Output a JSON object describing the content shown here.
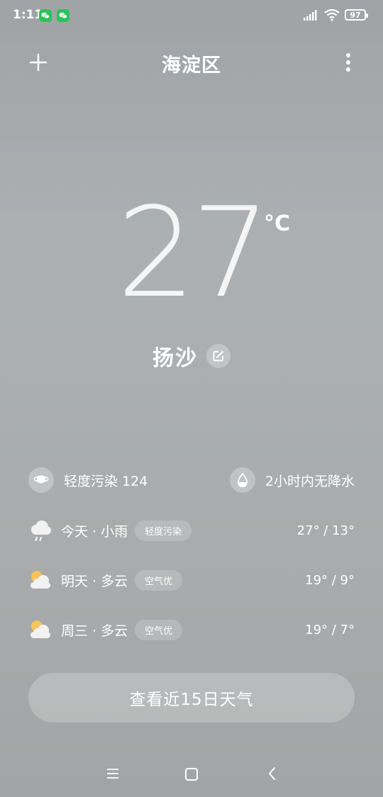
{
  "status_bar": {
    "time": "1:11",
    "battery": "97",
    "notification_icons": [
      "wechat-icon",
      "wechat-icon"
    ]
  },
  "header": {
    "title": "海淀区",
    "add_icon": "plus-icon",
    "more_icon": "more-vertical-icon"
  },
  "current": {
    "temperature": "27",
    "unit": "°C",
    "condition": "扬沙",
    "edit_icon": "edit-icon"
  },
  "info": {
    "air_quality": "轻度污染 124",
    "precipitation": "2小时内无降水"
  },
  "forecast": [
    {
      "day": "今天 · 小雨",
      "air": "轻度污染",
      "temps": "27° / 13°",
      "icon": "rain-cloud-icon"
    },
    {
      "day": "明天 · 多云",
      "air": "空气优",
      "temps": "19° / 9°",
      "icon": "partly-cloudy-icon"
    },
    {
      "day": "周三 · 多云",
      "air": "空气优",
      "temps": "19° / 7°",
      "icon": "partly-cloudy-icon"
    }
  ],
  "button_15day": "查看近15日天气",
  "colors": {
    "background": "#a9abac",
    "wechat_green": "#2bc35b",
    "sun_yellow": "#f7c35a"
  }
}
